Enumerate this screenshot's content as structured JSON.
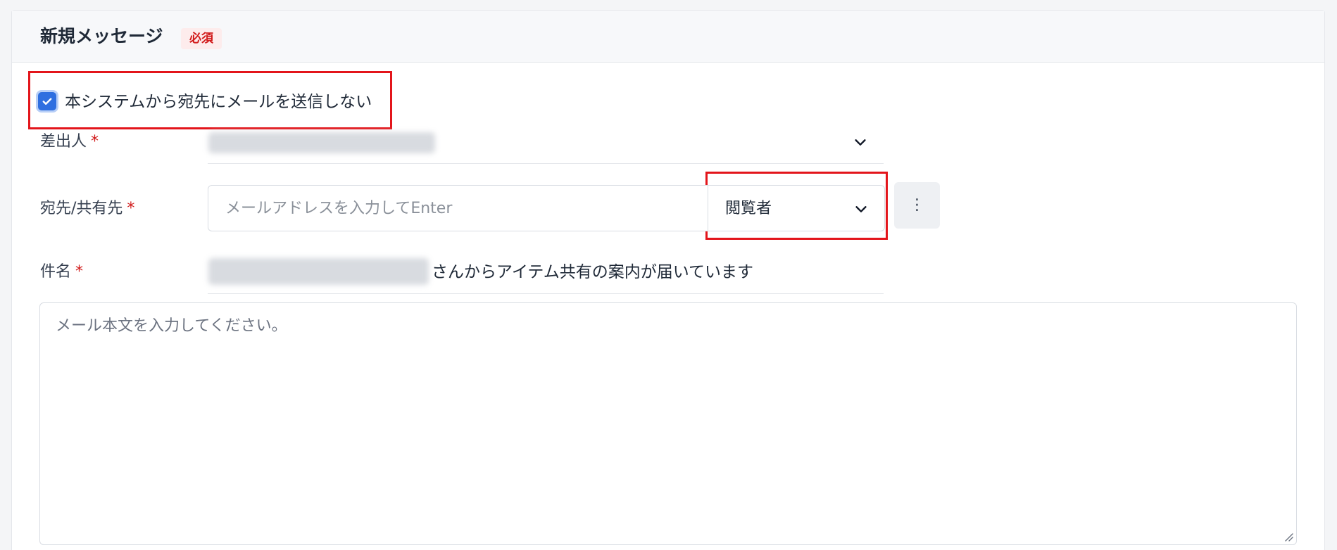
{
  "header": {
    "title": "新規メッセージ",
    "required_badge": "必須"
  },
  "no_email_option": {
    "label": "本システムから宛先にメールを送信しない",
    "checked": true
  },
  "sender": {
    "label": "差出人",
    "required_mark": "*",
    "icon": "chevron-down-icon"
  },
  "recipients": {
    "label": "宛先/共有先",
    "required_mark": "*",
    "placeholder": "メールアドレスを入力してEnter",
    "value": "",
    "role": "閲覧者",
    "role_icon": "chevron-down-icon",
    "more_icon": "vertical-ellipsis-icon",
    "more_glyph": "⋮"
  },
  "subject": {
    "label": "件名",
    "required_mark": "*",
    "suffix": "さんからアイテム共有の案内が届いています"
  },
  "message_body": {
    "placeholder": "メール本文を入力してください。",
    "value": ""
  },
  "colors": {
    "accent": "#2f6fe0",
    "required": "#d11a1a",
    "highlight": "#e3151b"
  }
}
